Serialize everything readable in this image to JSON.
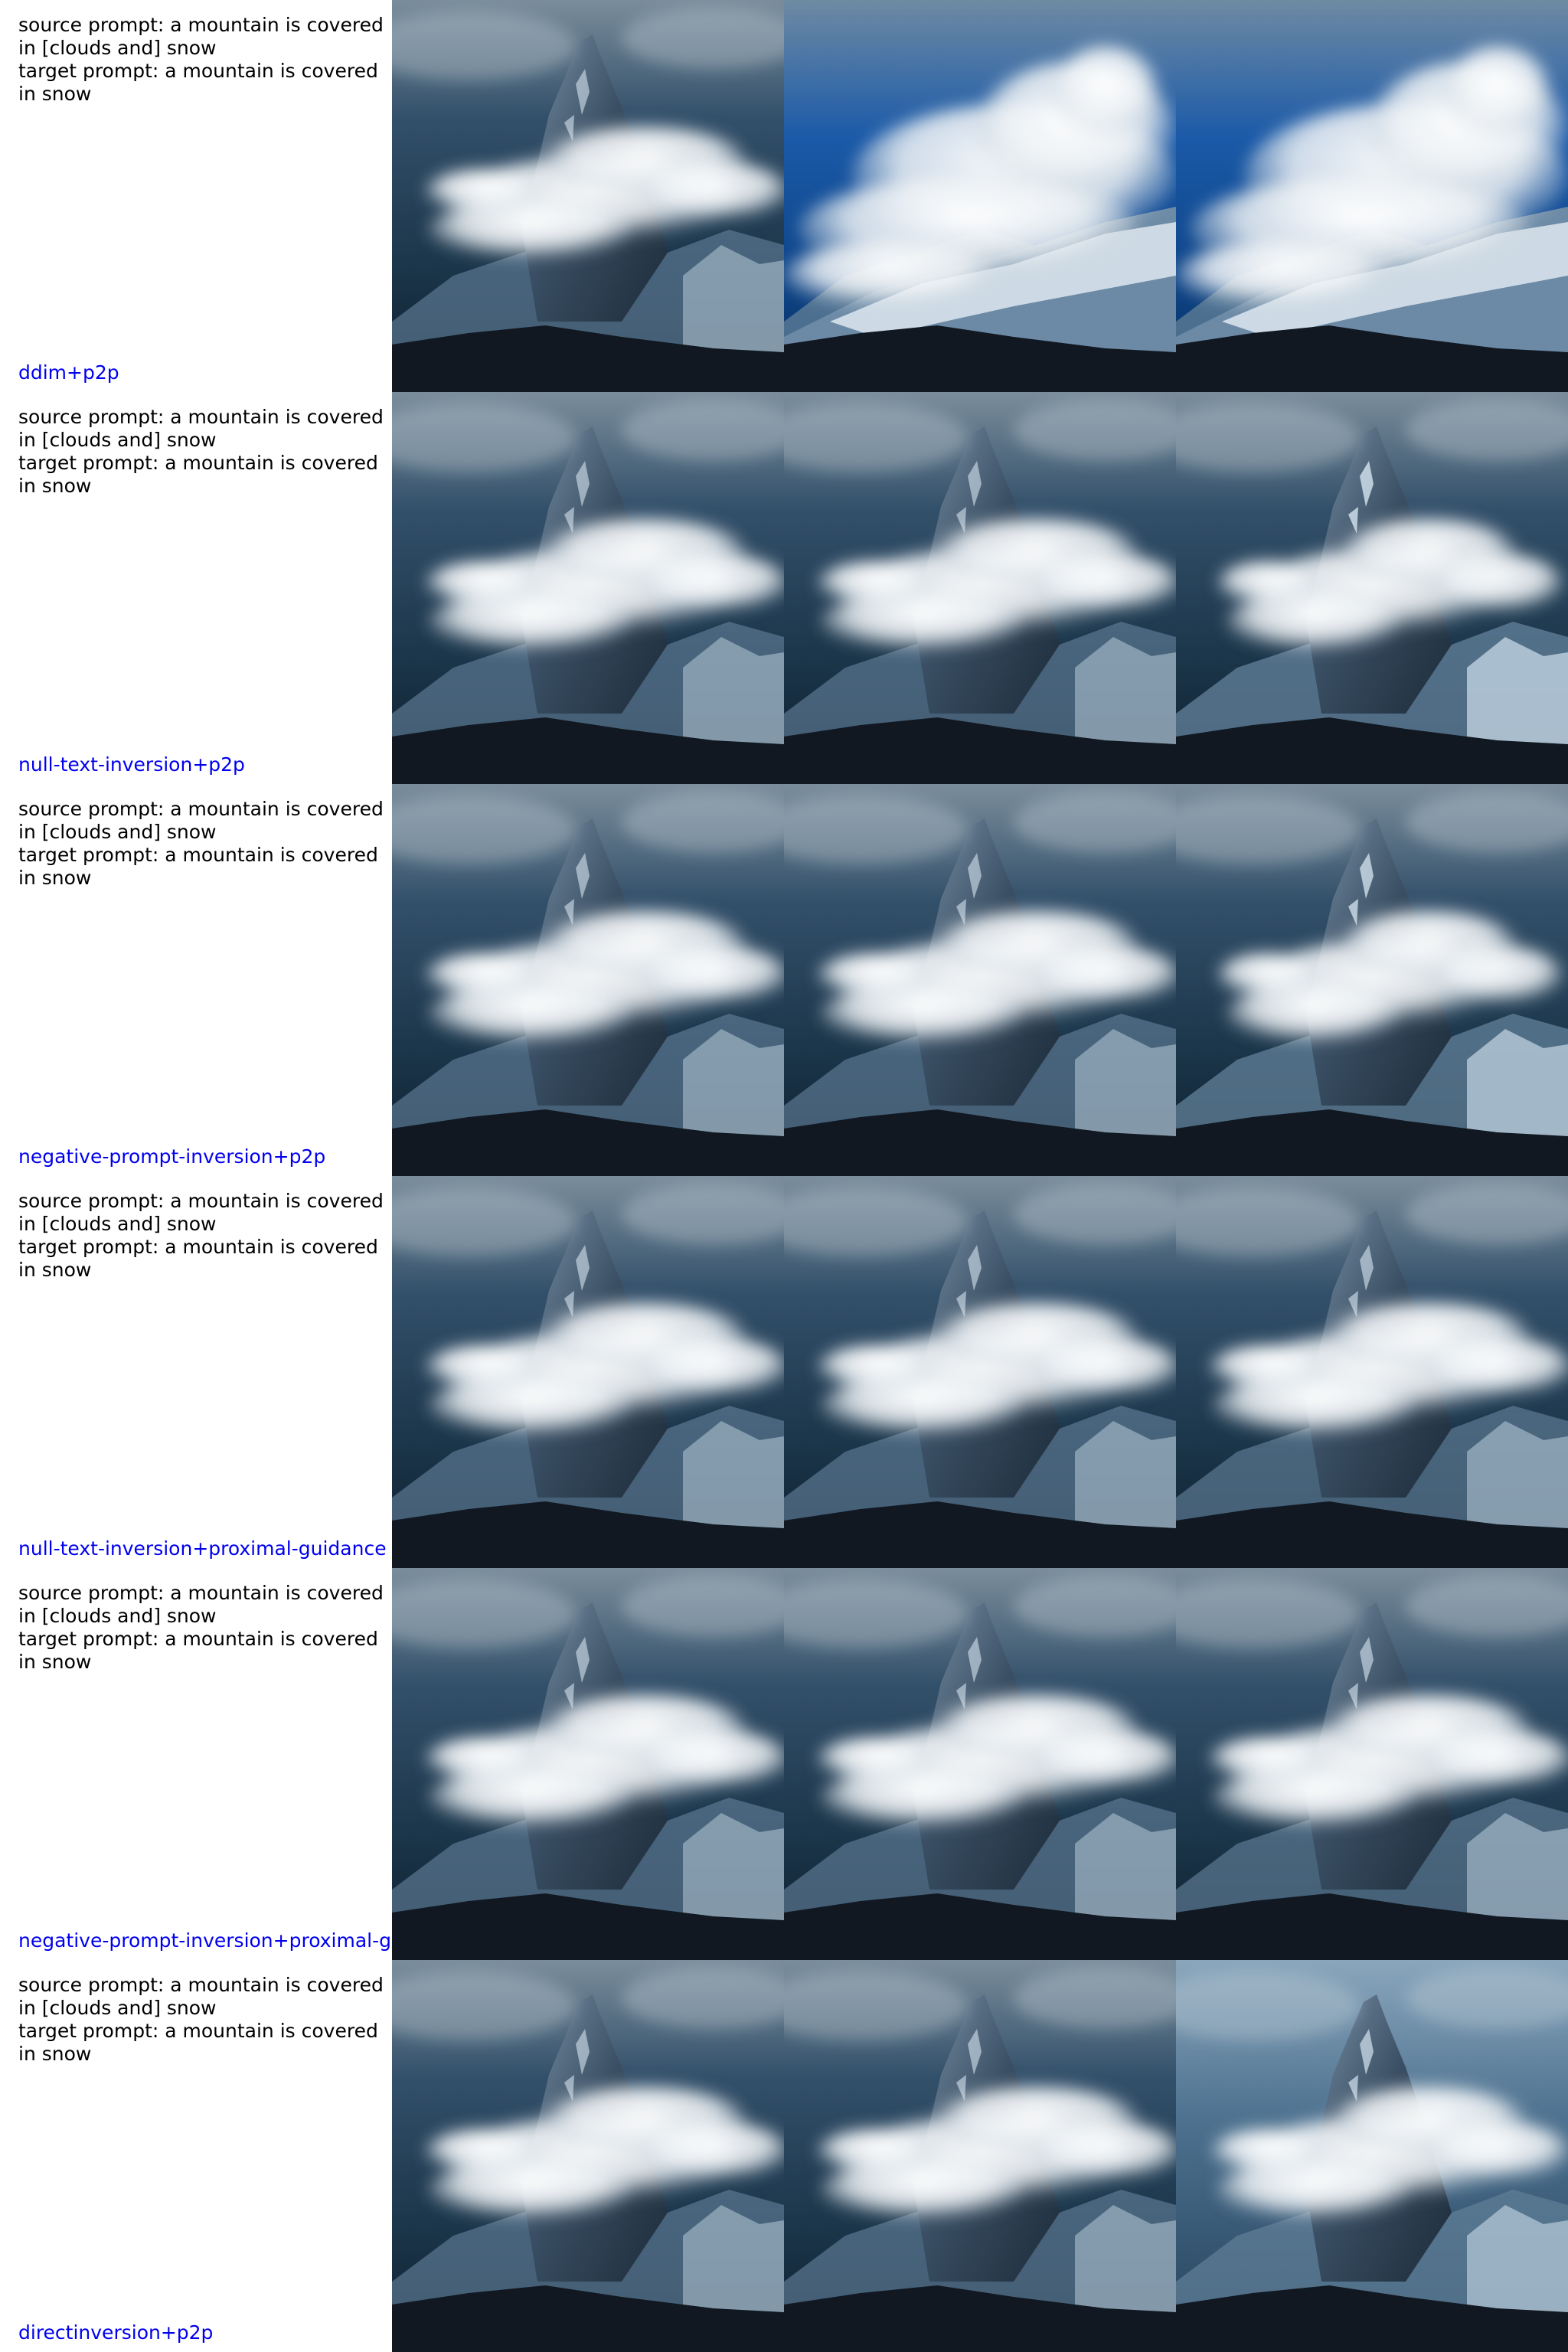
{
  "colors": {
    "prompt_text": "#000000",
    "method_text": "#0000ee",
    "background": "#ffffff",
    "sky_dark": "#142a3c",
    "sky_blue": "#0f4f9a",
    "cloud": "#eef2f5",
    "rock": "#3a4f64",
    "foreground": "#111822"
  },
  "prompt": {
    "source": "source prompt: a mountain is covered in [clouds and] snow",
    "target": "target prompt: a mountain is covered in snow"
  },
  "rows": [
    {
      "prompt_text": "source prompt: a mountain is covered\nin [clouds and] snow\ntarget prompt: a mountain is covered\nin snow",
      "method": "ddim+p2p",
      "images": [
        {
          "subject": "dark cloudy mountain peak",
          "variant": "source",
          "sky": "dark",
          "cloud_cover": 0.5,
          "fresh_snow": 0.2
        },
        {
          "subject": "mountain under large white cloud, blue sky",
          "variant": "blue-sky-cloud",
          "sky": "blue",
          "cloud_cover": 0.9,
          "fresh_snow": 0.6
        },
        {
          "subject": "mountain under large white cloud, blue sky",
          "variant": "blue-sky-cloud",
          "sky": "blue",
          "cloud_cover": 0.9,
          "fresh_snow": 0.6
        }
      ]
    },
    {
      "prompt_text": "source prompt: a mountain is covered\nin [clouds and] snow\ntarget prompt: a mountain is covered\nin snow",
      "method": "null-text-inversion+p2p",
      "images": [
        {
          "subject": "dark cloudy mountain peak",
          "variant": "source",
          "sky": "dark",
          "cloud_cover": 0.5,
          "fresh_snow": 0.2
        },
        {
          "subject": "dark cloudy mountain peak",
          "variant": "source",
          "sky": "dark",
          "cloud_cover": 0.5,
          "fresh_snow": 0.2
        },
        {
          "subject": "mountain with snowier slopes",
          "variant": "snowier",
          "sky": "dark",
          "cloud_cover": 0.35,
          "fresh_snow": 0.7
        }
      ]
    },
    {
      "prompt_text": "source prompt: a mountain is covered\nin [clouds and] snow\ntarget prompt: a mountain is covered\nin snow",
      "method": "negative-prompt-inversion+p2p",
      "images": [
        {
          "subject": "dark cloudy mountain peak",
          "variant": "source",
          "sky": "dark",
          "cloud_cover": 0.5,
          "fresh_snow": 0.2
        },
        {
          "subject": "dark cloudy mountain peak",
          "variant": "source",
          "sky": "dark",
          "cloud_cover": 0.5,
          "fresh_snow": 0.2
        },
        {
          "subject": "mountain with snowier slopes",
          "variant": "snowier",
          "sky": "dark",
          "cloud_cover": 0.35,
          "fresh_snow": 0.6
        }
      ]
    },
    {
      "prompt_text": "source prompt: a mountain is covered\nin [clouds and] snow\ntarget prompt: a mountain is covered\nin snow",
      "method": "null-text-inversion+proximal-guidance",
      "images": [
        {
          "subject": "dark cloudy mountain peak",
          "variant": "source",
          "sky": "dark",
          "cloud_cover": 0.5,
          "fresh_snow": 0.2
        },
        {
          "subject": "dark cloudy mountain peak",
          "variant": "source",
          "sky": "dark",
          "cloud_cover": 0.5,
          "fresh_snow": 0.2
        },
        {
          "subject": "dark cloudy mountain peak",
          "variant": "source",
          "sky": "dark",
          "cloud_cover": 0.5,
          "fresh_snow": 0.25
        }
      ]
    },
    {
      "prompt_text": "source prompt: a mountain is covered\nin [clouds and] snow\ntarget prompt: a mountain is covered\nin snow",
      "method": "negative-prompt-inversion+proximal-guidance",
      "images": [
        {
          "subject": "dark cloudy mountain peak",
          "variant": "source",
          "sky": "dark",
          "cloud_cover": 0.5,
          "fresh_snow": 0.2
        },
        {
          "subject": "dark cloudy mountain peak",
          "variant": "source",
          "sky": "dark",
          "cloud_cover": 0.5,
          "fresh_snow": 0.2
        },
        {
          "subject": "dark cloudy mountain peak",
          "variant": "source",
          "sky": "dark",
          "cloud_cover": 0.5,
          "fresh_snow": 0.25
        }
      ]
    },
    {
      "prompt_text": "source prompt: a mountain is covered\nin [clouds and] snow\ntarget prompt: a mountain is covered\nin snow",
      "method": "directinversion+p2p",
      "images": [
        {
          "subject": "dark cloudy mountain peak",
          "variant": "source",
          "sky": "dark",
          "cloud_cover": 0.5,
          "fresh_snow": 0.2
        },
        {
          "subject": "dark cloudy mountain peak",
          "variant": "source",
          "sky": "dark",
          "cloud_cover": 0.5,
          "fresh_snow": 0.2
        },
        {
          "subject": "mountain in lighter blue haze",
          "variant": "hazy",
          "sky": "light",
          "cloud_cover": 0.45,
          "fresh_snow": 0.45
        }
      ]
    }
  ]
}
